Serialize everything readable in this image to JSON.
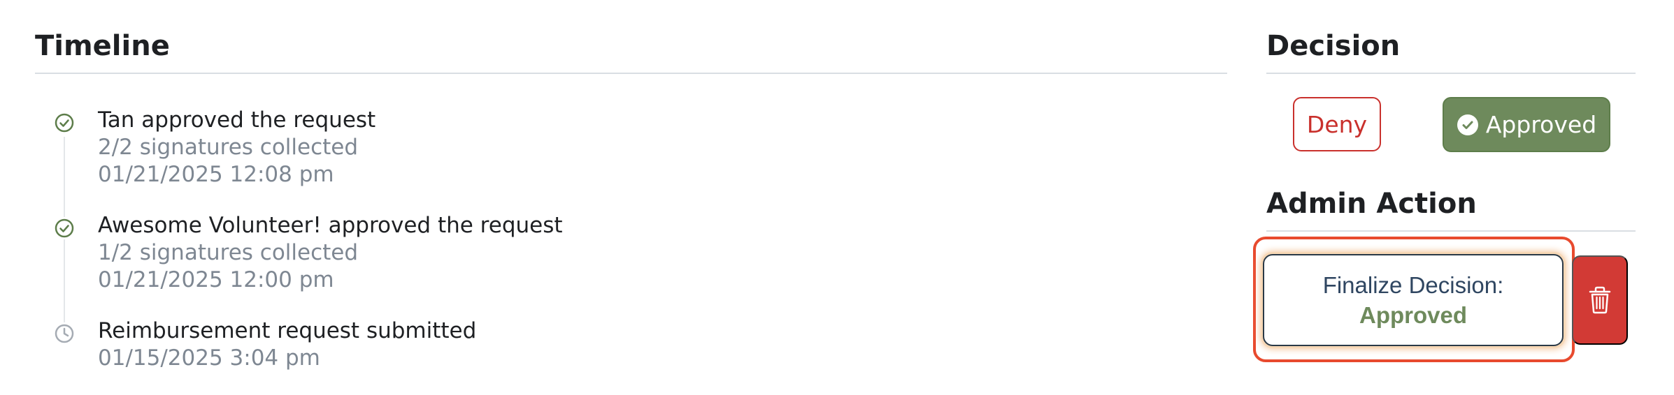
{
  "timeline": {
    "title": "Timeline",
    "events": [
      {
        "icon": "check-circle-icon",
        "title": "Tan approved the request",
        "signatures": "2/2 signatures collected",
        "timestamp": "01/21/2025 12:08 pm"
      },
      {
        "icon": "check-circle-icon",
        "title": "Awesome Volunteer! approved the request",
        "signatures": "1/2 signatures collected",
        "timestamp": "01/21/2025 12:00 pm"
      },
      {
        "icon": "clock-icon",
        "title": "Reimbursement request submitted",
        "timestamp": "01/15/2025 3:04 pm"
      }
    ]
  },
  "decision": {
    "title": "Decision",
    "deny_label": "Deny",
    "approved_label": "Approved"
  },
  "admin_action": {
    "title": "Admin Action",
    "finalize_label": "Finalize Decision:",
    "finalize_status": "Approved",
    "delete_icon": "trash-icon"
  },
  "colors": {
    "approved_green": "#6e8a5c",
    "deny_red": "#c9302c",
    "trash_red": "#d23a35",
    "highlight_orange": "#e84a2e"
  }
}
